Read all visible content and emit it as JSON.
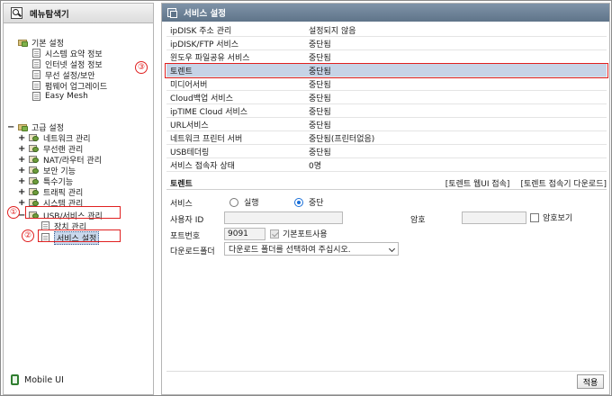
{
  "left_panel": {
    "title": "메뉴탐색기",
    "basic_group": "기본 설정",
    "basic_items": [
      "시스템 요약 정보",
      "인터넷 설정 정보",
      "무선 설정/보안",
      "펌웨어 업그레이드",
      "Easy Mesh"
    ],
    "advanced_group": "고급 설정",
    "advanced_items": [
      "네트워크 관리",
      "무선랜 관리",
      "NAT/라우터 관리",
      "보안 기능",
      "특수기능",
      "트래픽 관리",
      "시스템 관리",
      "USB/서비스 관리"
    ],
    "usb_children": [
      "장치 관리",
      "서비스 설정"
    ],
    "mobile": "Mobile UI",
    "callouts": [
      "①",
      "②",
      "③"
    ]
  },
  "right_panel": {
    "title": "서비스 설정",
    "services": [
      {
        "name": "ipDISK 주소 관리",
        "status": "설정되지 않음"
      },
      {
        "name": "ipDISK/FTP 서비스",
        "status": "중단됨"
      },
      {
        "name": "윈도우 파일공유 서비스",
        "status": "중단됨"
      },
      {
        "name": "토렌트",
        "status": "중단됨"
      },
      {
        "name": "미디어서버",
        "status": "중단됨"
      },
      {
        "name": "Cloud백업 서비스",
        "status": "중단됨"
      },
      {
        "name": "ipTIME Cloud 서비스",
        "status": "중단됨"
      },
      {
        "name": "URL서비스",
        "status": "중단됨"
      },
      {
        "name": "네트워크 프린터 서버",
        "status": "중단됨(프린터없음)"
      },
      {
        "name": "USB테더링",
        "status": "중단됨"
      },
      {
        "name": "서비스 접속자 상태",
        "status": "0명"
      }
    ],
    "torrent": {
      "title": "토렌트",
      "link_web": "[토렌트 웹UI 접속]",
      "link_download": "[토렌트 접속기 다운로드]",
      "service_label": "서비스",
      "run_label": "실행",
      "stop_label": "중단",
      "user_label": "사용자 ID",
      "password_label": "암호",
      "show_password": "암호보기",
      "port_label": "포트번호",
      "port_value": "9091",
      "default_port": "기본포트사용",
      "folder_label": "다운로드폴더",
      "folder_placeholder": "다운로드 폴더를 선택하여 주십시오."
    },
    "apply": "적용"
  },
  "colors": {
    "header": "#5f7489",
    "highlight": "#c6d3e6",
    "callout": "#e02020"
  }
}
